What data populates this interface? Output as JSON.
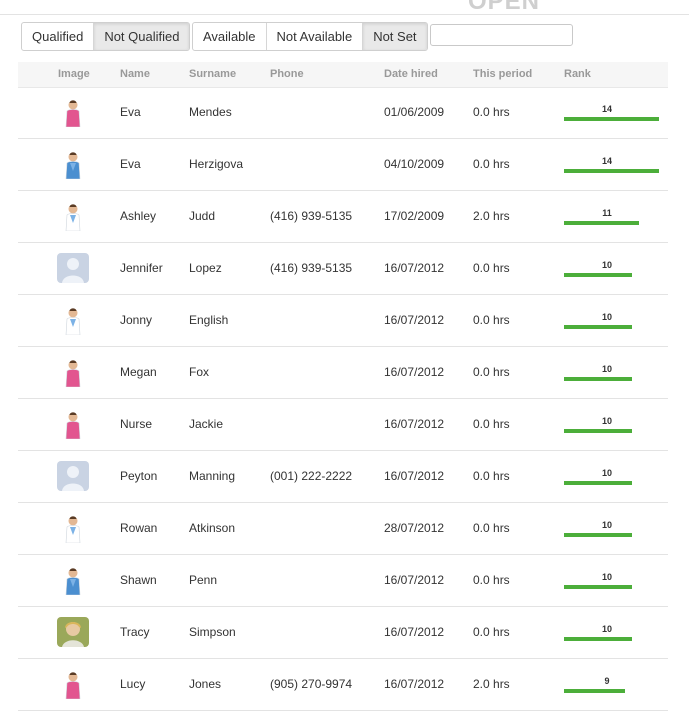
{
  "header": {
    "logo_text": "OPEN"
  },
  "filters": {
    "qualification": [
      {
        "label": "Qualified",
        "active": false
      },
      {
        "label": "Not Qualified",
        "active": true
      }
    ],
    "availability": [
      {
        "label": "Available",
        "active": false
      },
      {
        "label": "Not Available",
        "active": false
      },
      {
        "label": "Not Set",
        "active": true
      }
    ],
    "search_value": ""
  },
  "table": {
    "columns": [
      "Image",
      "Name",
      "Surname",
      "Phone",
      "Date hired",
      "This period",
      "Rank"
    ],
    "rank_max": 14,
    "rows": [
      {
        "avatar": "nurse-photo-avatar",
        "name": "Eva",
        "surname": "Mendes",
        "phone": "",
        "date_hired": "01/06/2009",
        "this_period": "0.0 hrs",
        "rank": "14"
      },
      {
        "avatar": "doctor-photo-avatar",
        "name": "Eva",
        "surname": "Herzigova",
        "phone": "",
        "date_hired": "04/10/2009",
        "this_period": "0.0 hrs",
        "rank": "14"
      },
      {
        "avatar": "doctor-photo-avatar",
        "name": "Ashley",
        "surname": "Judd",
        "phone": "(416) 939-5135",
        "date_hired": "17/02/2009",
        "this_period": "2.0 hrs",
        "rank": "11"
      },
      {
        "avatar": "placeholder-avatar",
        "name": "Jennifer",
        "surname": "Lopez",
        "phone": "(416) 939-5135",
        "date_hired": "16/07/2012",
        "this_period": "0.0 hrs",
        "rank": "10"
      },
      {
        "avatar": "doctor-photo-avatar",
        "name": "Jonny",
        "surname": "English",
        "phone": "",
        "date_hired": "16/07/2012",
        "this_period": "0.0 hrs",
        "rank": "10"
      },
      {
        "avatar": "nurse-photo-avatar",
        "name": "Megan",
        "surname": "Fox",
        "phone": "",
        "date_hired": "16/07/2012",
        "this_period": "0.0 hrs",
        "rank": "10"
      },
      {
        "avatar": "nurse-photo-avatar",
        "name": "Nurse",
        "surname": "Jackie",
        "phone": "",
        "date_hired": "16/07/2012",
        "this_period": "0.0 hrs",
        "rank": "10"
      },
      {
        "avatar": "placeholder-avatar",
        "name": "Peyton",
        "surname": "Manning",
        "phone": "(001) 222-2222",
        "date_hired": "16/07/2012",
        "this_period": "0.0 hrs",
        "rank": "10"
      },
      {
        "avatar": "doctor-photo-avatar",
        "name": "Rowan",
        "surname": "Atkinson",
        "phone": "",
        "date_hired": "28/07/2012",
        "this_period": "0.0 hrs",
        "rank": "10"
      },
      {
        "avatar": "doctor-photo-avatar",
        "name": "Shawn",
        "surname": "Penn",
        "phone": "",
        "date_hired": "16/07/2012",
        "this_period": "0.0 hrs",
        "rank": "10"
      },
      {
        "avatar": "person-photo-avatar",
        "name": "Tracy",
        "surname": "Simpson",
        "phone": "",
        "date_hired": "16/07/2012",
        "this_period": "0.0 hrs",
        "rank": "10"
      },
      {
        "avatar": "nurse-photo-avatar",
        "name": "Lucy",
        "surname": "Jones",
        "phone": "(905) 270-9974",
        "date_hired": "16/07/2012",
        "this_period": "2.0 hrs",
        "rank": "9"
      }
    ]
  },
  "colors": {
    "rank_bar": "#4cae3a",
    "placeholder_avatar": "#c9d3e3",
    "active_button": "#e9e9e9"
  }
}
